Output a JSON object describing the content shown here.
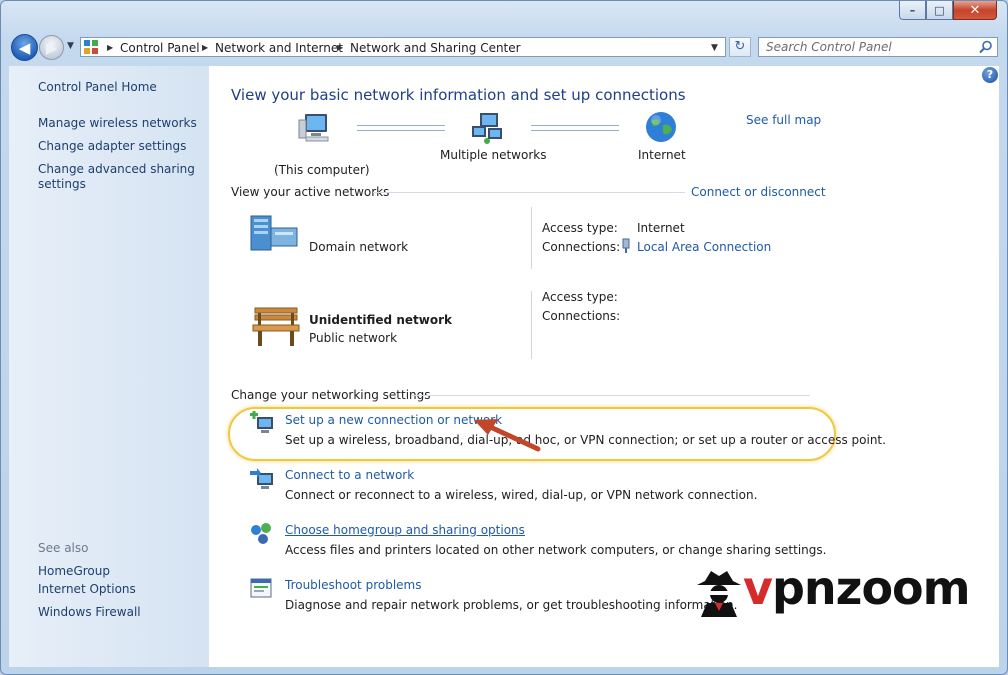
{
  "window": {
    "caption_buttons": {
      "minimize": "–",
      "maximize": "□",
      "close": "✕"
    }
  },
  "nav": {
    "back_glyph": "◀",
    "forward_glyph": "▶",
    "refresh_glyph": "↻",
    "dropdown_glyph": "▼"
  },
  "address": {
    "crumbs": [
      "Control Panel",
      "Network and Internet",
      "Network and Sharing Center"
    ],
    "separator": "▶"
  },
  "search": {
    "placeholder": "Search Control Panel"
  },
  "sidebar": {
    "home": "Control Panel Home",
    "tasks": [
      "Manage wireless networks",
      "Change adapter settings",
      "Change advanced sharing settings"
    ],
    "see_also_heading": "See also",
    "see_also": [
      "HomeGroup",
      "Internet Options",
      "Windows Firewall"
    ]
  },
  "main": {
    "heading": "View your basic network information and set up connections",
    "see_full_map": "See full map",
    "map": {
      "computer": "(This computer)",
      "networks": "Multiple networks",
      "internet": "Internet"
    },
    "active_heading": "View your active networks",
    "connect_disconnect": "Connect or disconnect",
    "networks": [
      {
        "name": "Domain network",
        "category": "",
        "access_label": "Access type:",
        "access_value": "Internet",
        "conn_label": "Connections:",
        "conn_value": "Local Area Connection"
      },
      {
        "name": "Unidentified network",
        "category": "Public network",
        "access_label": "Access type:",
        "access_value": "",
        "conn_label": "Connections:",
        "conn_value": ""
      }
    ],
    "settings_heading": "Change your networking settings",
    "settings": [
      {
        "title": "Set up a new connection or network",
        "desc": "Set up a wireless, broadband, dial-up, ad hoc, or VPN connection; or set up a router or access point."
      },
      {
        "title": "Connect to a network",
        "desc": "Connect or reconnect to a wireless, wired, dial-up, or VPN network connection."
      },
      {
        "title": "Choose homegroup and sharing options",
        "desc": "Access files and printers located on other network computers, or change sharing settings."
      },
      {
        "title": "Troubleshoot problems",
        "desc": "Diagnose and repair network problems, or get troubleshooting information."
      }
    ]
  },
  "help": "?",
  "logo": {
    "prefix": "v",
    "rest": "pnzoom"
  },
  "colors": {
    "link": "#1e5aa8",
    "highlight": "#f0c742",
    "arrow": "#c0472a",
    "logo_red": "#d52b2b"
  }
}
